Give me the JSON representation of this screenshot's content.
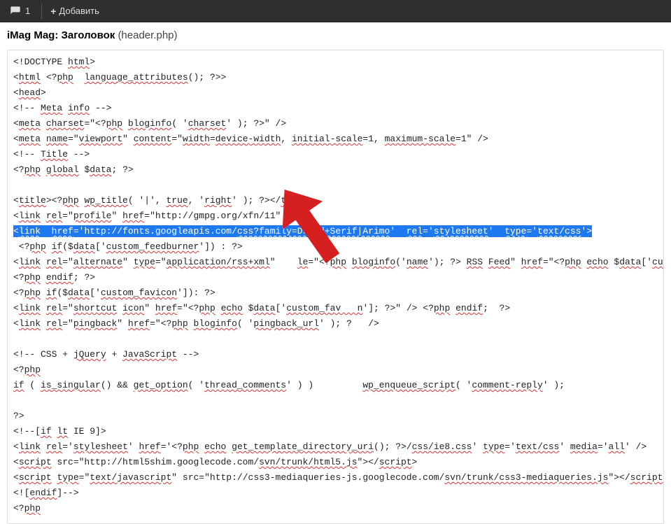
{
  "toolbar": {
    "comment_count": "1",
    "add_label": "Добавить"
  },
  "header": {
    "title_bold": "iMag Mag: Заголовок",
    "file": "(header.php)"
  },
  "code": {
    "lines": [
      {
        "t": "plain",
        "segs": [
          {
            "v": "<!DOCTYPE "
          },
          {
            "v": "html",
            "u": 1
          },
          {
            "v": ">"
          }
        ]
      },
      {
        "t": "plain",
        "segs": [
          {
            "v": "<"
          },
          {
            "v": "html",
            "u": 1
          },
          {
            "v": " <?"
          },
          {
            "v": "php",
            "u": 1
          },
          {
            "v": "  "
          },
          {
            "v": "language_attributes",
            "u": 1
          },
          {
            "v": "(); ?>>"
          }
        ]
      },
      {
        "t": "plain",
        "segs": [
          {
            "v": "<"
          },
          {
            "v": "head",
            "u": 1
          },
          {
            "v": ">"
          }
        ]
      },
      {
        "t": "plain",
        "segs": [
          {
            "v": "<!-- "
          },
          {
            "v": "Meta",
            "u": 1
          },
          {
            "v": " "
          },
          {
            "v": "info",
            "u": 1
          },
          {
            "v": " -->"
          }
        ]
      },
      {
        "t": "plain",
        "segs": [
          {
            "v": "<"
          },
          {
            "v": "meta",
            "u": 1
          },
          {
            "v": " "
          },
          {
            "v": "charset",
            "u": 1
          },
          {
            "v": "=\"<?"
          },
          {
            "v": "php",
            "u": 1
          },
          {
            "v": " "
          },
          {
            "v": "bloginfo",
            "u": 1
          },
          {
            "v": "( '"
          },
          {
            "v": "charset",
            "u": 1
          },
          {
            "v": "' ); ?>\" />"
          }
        ]
      },
      {
        "t": "plain",
        "segs": [
          {
            "v": "<"
          },
          {
            "v": "meta",
            "u": 1
          },
          {
            "v": " "
          },
          {
            "v": "name",
            "u": 1
          },
          {
            "v": "=\""
          },
          {
            "v": "viewport",
            "u": 1
          },
          {
            "v": "\" "
          },
          {
            "v": "content",
            "u": 1
          },
          {
            "v": "=\""
          },
          {
            "v": "width",
            "u": 1
          },
          {
            "v": "="
          },
          {
            "v": "device-width",
            "u": 1
          },
          {
            "v": ", "
          },
          {
            "v": "initial-scale",
            "u": 1
          },
          {
            "v": "=1, "
          },
          {
            "v": "maximum-scale",
            "u": 1
          },
          {
            "v": "=1\" />"
          }
        ]
      },
      {
        "t": "plain",
        "segs": [
          {
            "v": "<!-- "
          },
          {
            "v": "Title",
            "u": 1
          },
          {
            "v": " -->"
          }
        ]
      },
      {
        "t": "plain",
        "segs": [
          {
            "v": "<?"
          },
          {
            "v": "php",
            "u": 1
          },
          {
            "v": " "
          },
          {
            "v": "global",
            "u": 1
          },
          {
            "v": " $"
          },
          {
            "v": "data",
            "u": 1
          },
          {
            "v": "; ?>"
          }
        ]
      },
      {
        "t": "blank"
      },
      {
        "t": "plain",
        "segs": [
          {
            "v": "<"
          },
          {
            "v": "title",
            "u": 1
          },
          {
            "v": "><?"
          },
          {
            "v": "php",
            "u": 1
          },
          {
            "v": " "
          },
          {
            "v": "wp_title",
            "u": 1
          },
          {
            "v": "( '|', "
          },
          {
            "v": "true",
            "u": 1
          },
          {
            "v": ", '"
          },
          {
            "v": "right",
            "u": 1
          },
          {
            "v": "' ); ?></"
          },
          {
            "v": "title",
            "u": 1
          },
          {
            "v": ">"
          }
        ]
      },
      {
        "t": "plain",
        "segs": [
          {
            "v": "<"
          },
          {
            "v": "link",
            "u": 1
          },
          {
            "v": " "
          },
          {
            "v": "rel",
            "u": 1
          },
          {
            "v": "=\""
          },
          {
            "v": "profile",
            "u": 1
          },
          {
            "v": "\" "
          },
          {
            "v": "href",
            "u": 1
          },
          {
            "v": "=\"http://gmpg.org/xfn/11\" />"
          }
        ]
      },
      {
        "t": "selected",
        "segs": [
          {
            "v": "<"
          },
          {
            "v": "link",
            "u": 1
          },
          {
            "v": "  "
          },
          {
            "v": "href",
            "u": 1
          },
          {
            "v": "='http://fonts.googleapis.com/"
          },
          {
            "v": "css?family=Droid+Serif|Arimo",
            "u": 1
          },
          {
            "v": "'  "
          },
          {
            "v": "rel",
            "u": 1
          },
          {
            "v": "='"
          },
          {
            "v": "stylesheet",
            "u": 1
          },
          {
            "v": "'  "
          },
          {
            "v": "type",
            "u": 1
          },
          {
            "v": "='"
          },
          {
            "v": "text/css",
            "u": 1
          },
          {
            "v": "'>"
          }
        ]
      },
      {
        "t": "plain",
        "segs": [
          {
            "v": " <?"
          },
          {
            "v": "php",
            "u": 1
          },
          {
            "v": " "
          },
          {
            "v": "if",
            "u": 1
          },
          {
            "v": "($"
          },
          {
            "v": "data",
            "u": 1
          },
          {
            "v": "['"
          },
          {
            "v": "custom_feedburner",
            "u": 1
          },
          {
            "v": "']) : ?>"
          }
        ]
      },
      {
        "t": "plain",
        "segs": [
          {
            "v": "<"
          },
          {
            "v": "link",
            "u": 1
          },
          {
            "v": " "
          },
          {
            "v": "rel",
            "u": 1
          },
          {
            "v": "=\""
          },
          {
            "v": "alternate",
            "u": 1
          },
          {
            "v": "\" "
          },
          {
            "v": "type",
            "u": 1
          },
          {
            "v": "=\""
          },
          {
            "v": "application/rss+xml",
            "u": 1
          },
          {
            "v": "\"    "
          },
          {
            "v": "le",
            "u": 1
          },
          {
            "v": "=\"<?"
          },
          {
            "v": "php",
            "u": 1
          },
          {
            "v": " "
          },
          {
            "v": "bloginfo",
            "u": 1
          },
          {
            "v": "('"
          },
          {
            "v": "name",
            "u": 1
          },
          {
            "v": "'); ?> "
          },
          {
            "v": "RSS",
            "u": 1
          },
          {
            "v": " "
          },
          {
            "v": "Feed",
            "u": 1
          },
          {
            "v": "\" "
          },
          {
            "v": "href",
            "u": 1
          },
          {
            "v": "=\"<?"
          },
          {
            "v": "php",
            "u": 1
          },
          {
            "v": " "
          },
          {
            "v": "echo",
            "u": 1
          },
          {
            "v": " $"
          },
          {
            "v": "data",
            "u": 1
          },
          {
            "v": "['"
          },
          {
            "v": "custom_feedburner",
            "u": 1
          },
          {
            "v": "'"
          }
        ]
      },
      {
        "t": "plain",
        "segs": [
          {
            "v": "<?"
          },
          {
            "v": "php",
            "u": 1
          },
          {
            "v": " "
          },
          {
            "v": "endif",
            "u": 1
          },
          {
            "v": "; ?>"
          }
        ]
      },
      {
        "t": "plain",
        "segs": [
          {
            "v": "<?"
          },
          {
            "v": "php",
            "u": 1
          },
          {
            "v": " "
          },
          {
            "v": "if",
            "u": 1
          },
          {
            "v": "($"
          },
          {
            "v": "data",
            "u": 1
          },
          {
            "v": "['"
          },
          {
            "v": "custom_favicon",
            "u": 1
          },
          {
            "v": "']): ?>"
          }
        ]
      },
      {
        "t": "plain",
        "segs": [
          {
            "v": "<"
          },
          {
            "v": "link",
            "u": 1
          },
          {
            "v": " "
          },
          {
            "v": "rel",
            "u": 1
          },
          {
            "v": "=\""
          },
          {
            "v": "shortcut",
            "u": 1
          },
          {
            "v": " "
          },
          {
            "v": "icon",
            "u": 1
          },
          {
            "v": "\" "
          },
          {
            "v": "href",
            "u": 1
          },
          {
            "v": "=\"<?"
          },
          {
            "v": "php",
            "u": 1
          },
          {
            "v": " "
          },
          {
            "v": "echo",
            "u": 1
          },
          {
            "v": " $"
          },
          {
            "v": "data",
            "u": 1
          },
          {
            "v": "['"
          },
          {
            "v": "custom_fav   n",
            "u": 1
          },
          {
            "v": "']; ?>\" /> <?"
          },
          {
            "v": "php",
            "u": 1
          },
          {
            "v": " "
          },
          {
            "v": "endif",
            "u": 1
          },
          {
            "v": ";  ?>"
          }
        ]
      },
      {
        "t": "plain",
        "segs": [
          {
            "v": "<"
          },
          {
            "v": "link",
            "u": 1
          },
          {
            "v": " "
          },
          {
            "v": "rel",
            "u": 1
          },
          {
            "v": "=\""
          },
          {
            "v": "pingback",
            "u": 1
          },
          {
            "v": "\" "
          },
          {
            "v": "href",
            "u": 1
          },
          {
            "v": "=\"<?"
          },
          {
            "v": "php",
            "u": 1
          },
          {
            "v": " "
          },
          {
            "v": "bloginfo",
            "u": 1
          },
          {
            "v": "( '"
          },
          {
            "v": "pingback_url",
            "u": 1
          },
          {
            "v": "' ); ?   />"
          }
        ]
      },
      {
        "t": "blank"
      },
      {
        "t": "plain",
        "segs": [
          {
            "v": "<!-- CSS + "
          },
          {
            "v": "jQuery",
            "u": 1
          },
          {
            "v": " + "
          },
          {
            "v": "JavaScript",
            "u": 1
          },
          {
            "v": " -->"
          }
        ]
      },
      {
        "t": "plain",
        "segs": [
          {
            "v": "<?"
          },
          {
            "v": "php",
            "u": 1
          }
        ]
      },
      {
        "t": "plain",
        "segs": [
          {
            "v": "if",
            "u": 1
          },
          {
            "v": " ( "
          },
          {
            "v": "is_singular",
            "u": 1
          },
          {
            "v": "() && "
          },
          {
            "v": "get_option",
            "u": 1
          },
          {
            "v": "( '"
          },
          {
            "v": "thread_comments",
            "u": 1
          },
          {
            "v": "' ) )         "
          },
          {
            "v": "wp_enqueue_script",
            "u": 1
          },
          {
            "v": "( '"
          },
          {
            "v": "comment-reply",
            "u": 1
          },
          {
            "v": "' );"
          }
        ]
      },
      {
        "t": "blank"
      },
      {
        "t": "plain",
        "segs": [
          {
            "v": "?>"
          }
        ]
      },
      {
        "t": "plain",
        "segs": [
          {
            "v": "<!--["
          },
          {
            "v": "if",
            "u": 1
          },
          {
            "v": " "
          },
          {
            "v": "lt",
            "u": 1
          },
          {
            "v": " IE 9]>"
          }
        ]
      },
      {
        "t": "plain",
        "segs": [
          {
            "v": "<"
          },
          {
            "v": "link",
            "u": 1
          },
          {
            "v": " "
          },
          {
            "v": "rel",
            "u": 1
          },
          {
            "v": "='"
          },
          {
            "v": "stylesheet",
            "u": 1
          },
          {
            "v": "' "
          },
          {
            "v": "href",
            "u": 1
          },
          {
            "v": "='<?"
          },
          {
            "v": "php",
            "u": 1
          },
          {
            "v": " "
          },
          {
            "v": "echo",
            "u": 1
          },
          {
            "v": " "
          },
          {
            "v": "get_template_directory_uri",
            "u": 1
          },
          {
            "v": "(); ?>/"
          },
          {
            "v": "css/ie8.css",
            "u": 1
          },
          {
            "v": "' "
          },
          {
            "v": "type",
            "u": 1
          },
          {
            "v": "='"
          },
          {
            "v": "text/css",
            "u": 1
          },
          {
            "v": "' "
          },
          {
            "v": "media",
            "u": 1
          },
          {
            "v": "='"
          },
          {
            "v": "all",
            "u": 1
          },
          {
            "v": "' />"
          }
        ]
      },
      {
        "t": "plain",
        "segs": [
          {
            "v": "<"
          },
          {
            "v": "script",
            "u": 1
          },
          {
            "v": " src=\"http://html5shim.googlecode.com/"
          },
          {
            "v": "svn/trunk/html5.js",
            "u": 1
          },
          {
            "v": "\"></"
          },
          {
            "v": "script",
            "u": 1
          },
          {
            "v": ">"
          }
        ]
      },
      {
        "t": "plain",
        "segs": [
          {
            "v": "<"
          },
          {
            "v": "script",
            "u": 1
          },
          {
            "v": " "
          },
          {
            "v": "type",
            "u": 1
          },
          {
            "v": "=\""
          },
          {
            "v": "text/javascript",
            "u": 1
          },
          {
            "v": "\" src=\"http://css3-mediaqueries-js.googlecode.com/"
          },
          {
            "v": "svn/trunk/css3-mediaqueries.js",
            "u": 1
          },
          {
            "v": "\"></"
          },
          {
            "v": "script",
            "u": 1
          },
          {
            "v": ">"
          }
        ]
      },
      {
        "t": "plain",
        "segs": [
          {
            "v": "<!["
          },
          {
            "v": "endif",
            "u": 1
          },
          {
            "v": "]-->"
          }
        ]
      },
      {
        "t": "plain",
        "segs": [
          {
            "v": "<?"
          },
          {
            "v": "php",
            "u": 1
          }
        ]
      }
    ]
  }
}
